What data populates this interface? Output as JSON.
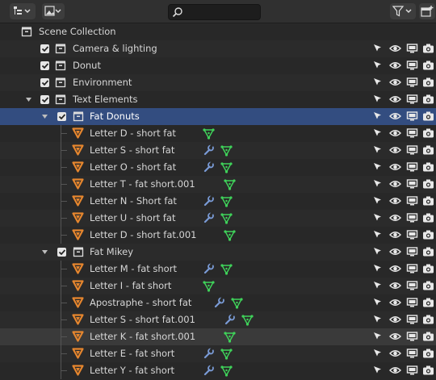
{
  "search": {
    "value": "",
    "placeholder": ""
  },
  "colors": {
    "selected_row": "#334d80",
    "object_orange": "#e6862e",
    "modifier_blue": "#7a9bd6",
    "mesh_green": "#3fd35a"
  },
  "rows": [
    {
      "label": "Scene Collection"
    },
    {
      "label": "Camera & lighting"
    },
    {
      "label": "Donut"
    },
    {
      "label": "Environment"
    },
    {
      "label": "Text Elements"
    },
    {
      "label": "Fat Donuts"
    },
    {
      "label": "Letter D - short fat"
    },
    {
      "label": "Letter S - short fat"
    },
    {
      "label": "Letter O - short fat"
    },
    {
      "label": "Letter T - fat short.001"
    },
    {
      "label": "Letter N - Short fat"
    },
    {
      "label": "Letter U - short fat"
    },
    {
      "label": "Letter D - short fat.001"
    },
    {
      "label": "Fat Mikey"
    },
    {
      "label": "Letter M - fat short"
    },
    {
      "label": "Letter I - fat short"
    },
    {
      "label": "Apostraphe - short fat"
    },
    {
      "label": "Letter S - short fat.001"
    },
    {
      "label": "Letter K - fat short.001"
    },
    {
      "label": "Letter E - fat short"
    },
    {
      "label": "Letter Y - fat short"
    }
  ]
}
